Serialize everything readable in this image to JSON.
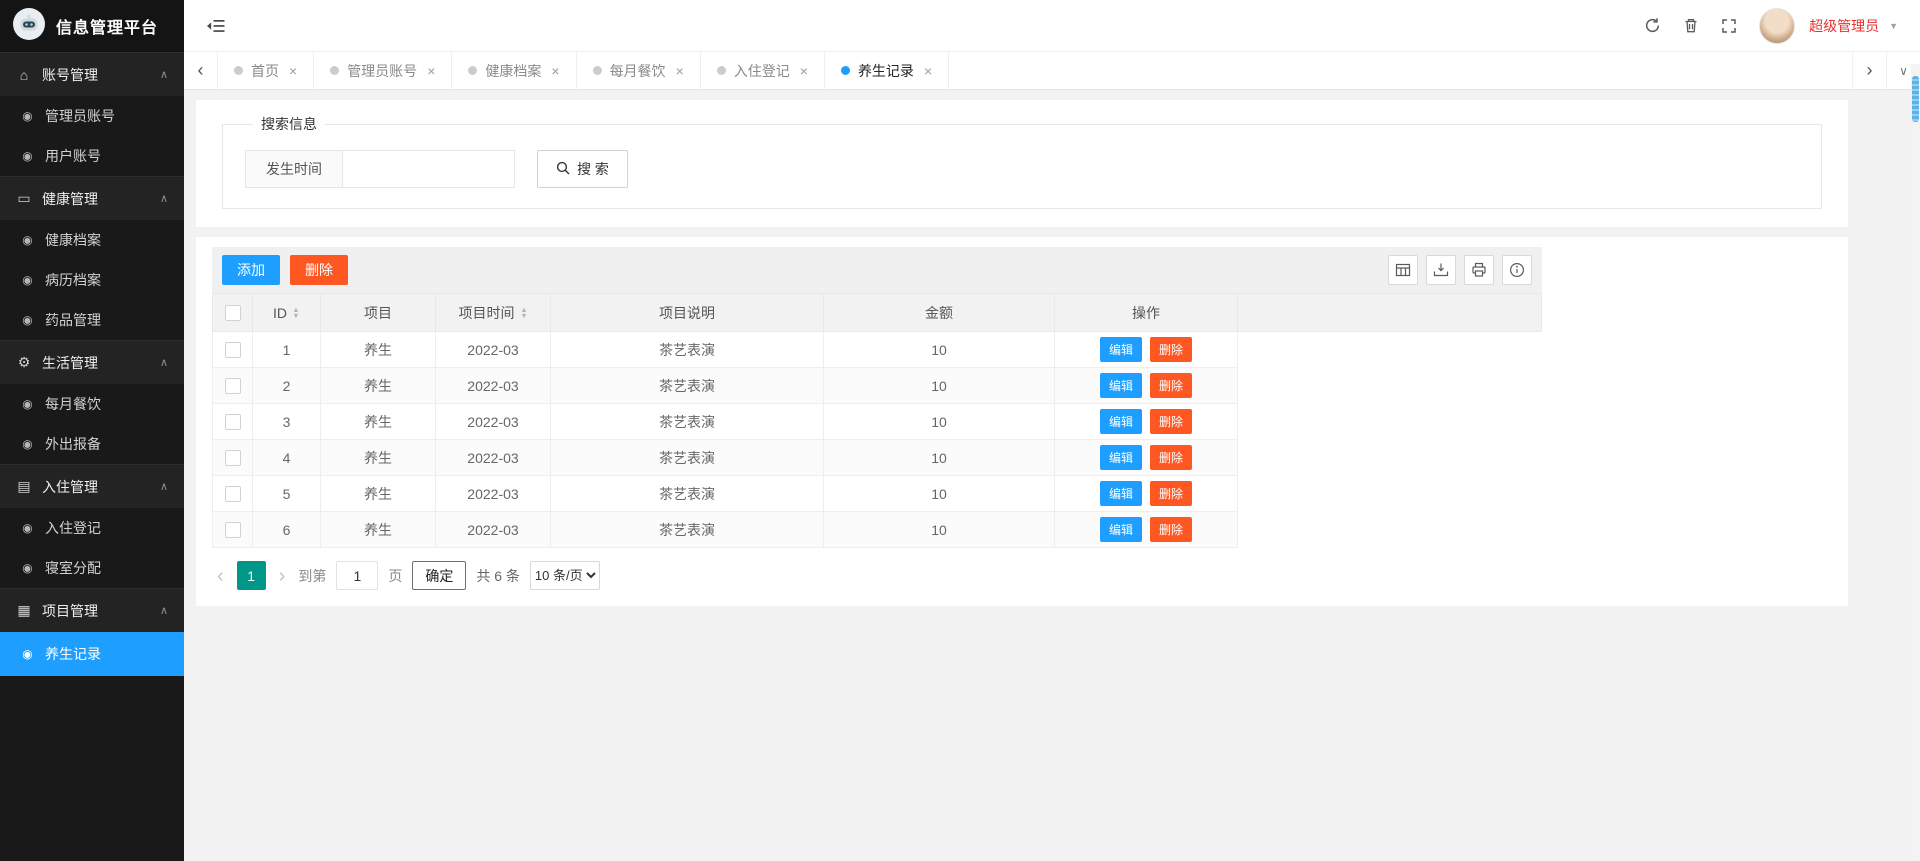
{
  "colors": {
    "accent_blue": "#1E9FFF",
    "danger_orange": "#FF5722",
    "pager_green": "#009688",
    "username_red": "#e8322e",
    "scrollbar_blue": "#5fb1e4"
  },
  "sidebar": {
    "logo_title": "信息管理平台",
    "active_item": "养生记录",
    "menu": [
      {
        "label": "账号管理",
        "icon": "home-icon",
        "children": [
          "管理员账号",
          "用户账号"
        ]
      },
      {
        "label": "健康管理",
        "icon": "panel-icon",
        "children": [
          "健康档案",
          "病历档案",
          "药品管理"
        ]
      },
      {
        "label": "生活管理",
        "icon": "gears-icon",
        "children": [
          "每月餐饮",
          "外出报备"
        ]
      },
      {
        "label": "入住管理",
        "icon": "document-icon",
        "children": [
          "入住登记",
          "寝室分配"
        ]
      },
      {
        "label": "项目管理",
        "icon": "calendar-icon",
        "children": [
          "养生记录"
        ]
      }
    ]
  },
  "topbar": {
    "username": "超级管理员"
  },
  "tabbar": {
    "tabs": [
      {
        "label": "首页",
        "active": false
      },
      {
        "label": "管理员账号",
        "active": false
      },
      {
        "label": "健康档案",
        "active": false
      },
      {
        "label": "每月餐饮",
        "active": false
      },
      {
        "label": "入住登记",
        "active": false
      },
      {
        "label": "养生记录",
        "active": true
      }
    ]
  },
  "search": {
    "legend": "搜索信息",
    "date_label": "发生时间",
    "date_value": "",
    "button_label": "搜 索"
  },
  "toolbar": {
    "add_label": "添加",
    "delete_label": "删除",
    "icons": [
      "columns-icon",
      "export-icon",
      "print-icon",
      "info-icon"
    ]
  },
  "table": {
    "columns": [
      {
        "label": "ID",
        "sortable": true
      },
      {
        "label": "项目",
        "sortable": false
      },
      {
        "label": "项目时间",
        "sortable": true
      },
      {
        "label": "项目说明",
        "sortable": false
      },
      {
        "label": "金额",
        "sortable": false
      },
      {
        "label": "操作",
        "sortable": false
      }
    ],
    "edit_label": "编辑",
    "delete_label": "删除",
    "rows": [
      {
        "id": "1",
        "project": "养生",
        "time": "2022-03",
        "description": "茶艺表演",
        "amount": "10"
      },
      {
        "id": "2",
        "project": "养生",
        "time": "2022-03",
        "description": "茶艺表演",
        "amount": "10"
      },
      {
        "id": "3",
        "project": "养生",
        "time": "2022-03",
        "description": "茶艺表演",
        "amount": "10"
      },
      {
        "id": "4",
        "project": "养生",
        "time": "2022-03",
        "description": "茶艺表演",
        "amount": "10"
      },
      {
        "id": "5",
        "project": "养生",
        "time": "2022-03",
        "description": "茶艺表演",
        "amount": "10"
      },
      {
        "id": "6",
        "project": "养生",
        "time": "2022-03",
        "description": "茶艺表演",
        "amount": "10"
      }
    ]
  },
  "pagination": {
    "current_page": "1",
    "goto_prefix": "到第",
    "goto_value": "1",
    "goto_suffix": "页",
    "confirm_label": "确定",
    "total_label": "共 6 条",
    "per_page_value": "10 条/页"
  }
}
